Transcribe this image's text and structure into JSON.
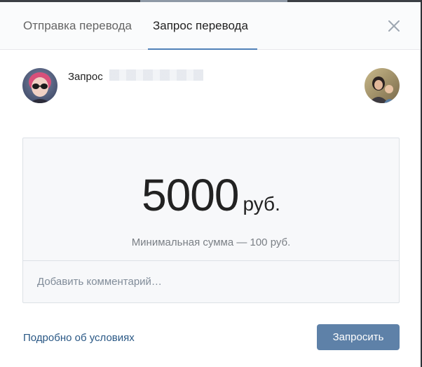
{
  "tabs": [
    {
      "label": "Отправка перевода",
      "active": false
    },
    {
      "label": "Запрос перевода",
      "active": true
    }
  ],
  "close_icon": "close-icon",
  "request": {
    "label": "Запрос"
  },
  "amount": {
    "value": "5000",
    "currency": "руб.",
    "min_note": "Минимальная сумма — 100 руб."
  },
  "comment": {
    "placeholder": "Добавить комментарий…",
    "value": ""
  },
  "footer": {
    "terms_link": "Подробно об условиях",
    "submit_label": "Запросить"
  },
  "colors": {
    "accent": "#5181b8",
    "button": "#5e81a8",
    "link": "#2a5885",
    "header_bg": "#fafbfc",
    "box_bg": "#f7f8fa"
  }
}
